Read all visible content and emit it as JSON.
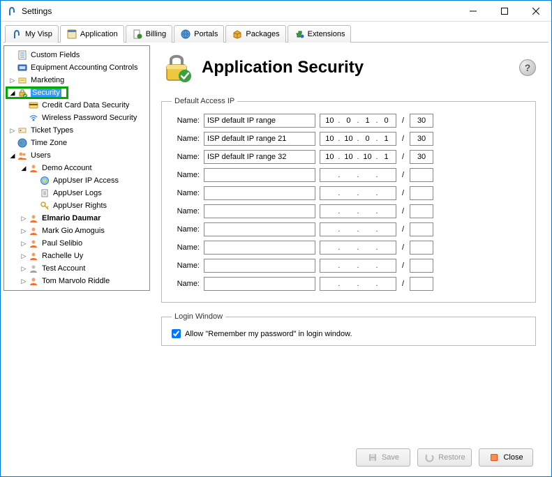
{
  "window": {
    "title": "Settings"
  },
  "tabs": [
    {
      "label": "My Visp"
    },
    {
      "label": "Application"
    },
    {
      "label": "Billing"
    },
    {
      "label": "Portals"
    },
    {
      "label": "Packages"
    },
    {
      "label": "Extensions"
    }
  ],
  "tree": {
    "custom_fields": "Custom Fields",
    "equipment": "Equipment Accounting Controls",
    "marketing": "Marketing",
    "security": "Security",
    "cc_security": "Credit Card Data Security",
    "wifi_security": "Wireless Password Security",
    "ticket_types": "Ticket Types",
    "time_zone": "Time Zone",
    "users": "Users",
    "demo_account": "Demo Account",
    "appuser_ip": "AppUser IP Access",
    "appuser_logs": "AppUser Logs",
    "appuser_rights": "AppUser Rights",
    "user_1": "Elmario Daumar",
    "user_2": "Mark Gio Amoguis",
    "user_3": "Paul Selibio",
    "user_4": "Rachelle Uy",
    "user_5": "Test Account",
    "user_6": "Tom Marvolo Riddle"
  },
  "page": {
    "title": "Application Security",
    "group_ip": "Default Access IP",
    "group_login": "Login Window",
    "checkbox_label": "Allow \"Remember my password\" in login window.",
    "checkbox_checked": true
  },
  "ip_rows": [
    {
      "label": "Name:",
      "name": "ISP default IP range",
      "o1": "10",
      "o2": "0",
      "o3": "1",
      "o4": "0",
      "mask": "30"
    },
    {
      "label": "Name:",
      "name": "ISP default IP range 21",
      "o1": "10",
      "o2": "10",
      "o3": "0",
      "o4": "1",
      "mask": "30"
    },
    {
      "label": "Name:",
      "name": "ISP default IP range 32",
      "o1": "10",
      "o2": "10",
      "o3": "10",
      "o4": "1",
      "mask": "30"
    },
    {
      "label": "Name:",
      "name": "",
      "o1": "",
      "o2": "",
      "o3": "",
      "o4": "",
      "mask": ""
    },
    {
      "label": "Name:",
      "name": "",
      "o1": "",
      "o2": "",
      "o3": "",
      "o4": "",
      "mask": ""
    },
    {
      "label": "Name:",
      "name": "",
      "o1": "",
      "o2": "",
      "o3": "",
      "o4": "",
      "mask": ""
    },
    {
      "label": "Name:",
      "name": "",
      "o1": "",
      "o2": "",
      "o3": "",
      "o4": "",
      "mask": ""
    },
    {
      "label": "Name:",
      "name": "",
      "o1": "",
      "o2": "",
      "o3": "",
      "o4": "",
      "mask": ""
    },
    {
      "label": "Name:",
      "name": "",
      "o1": "",
      "o2": "",
      "o3": "",
      "o4": "",
      "mask": ""
    },
    {
      "label": "Name:",
      "name": "",
      "o1": "",
      "o2": "",
      "o3": "",
      "o4": "",
      "mask": ""
    }
  ],
  "buttons": {
    "save": "Save",
    "restore": "Restore",
    "close": "Close"
  }
}
